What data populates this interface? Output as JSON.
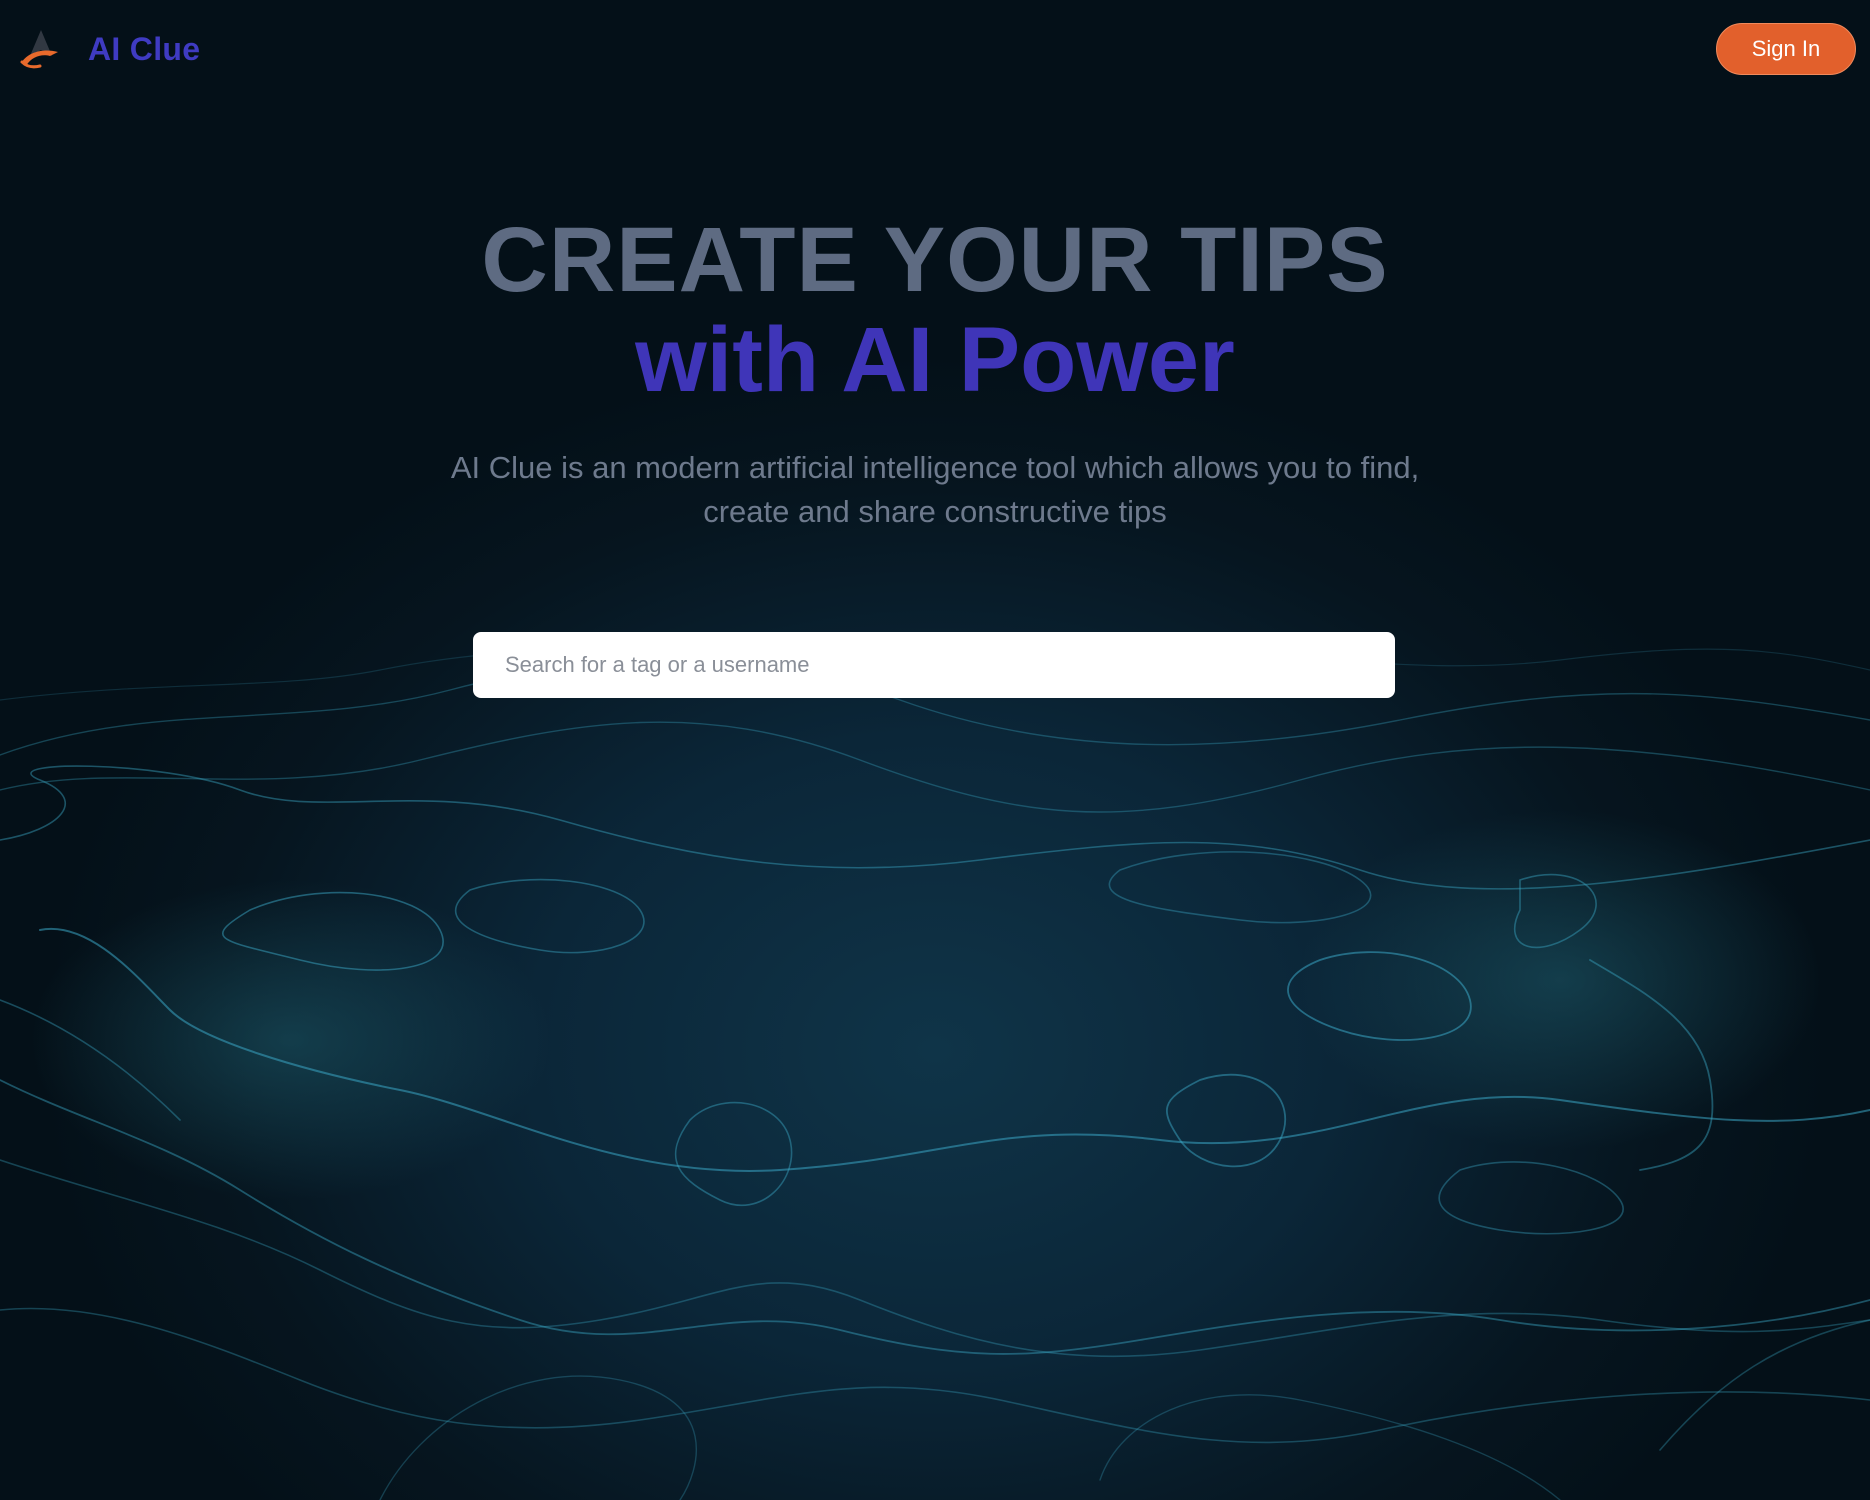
{
  "brand": {
    "name": "AI Clue",
    "logo_icon": "rocket-arrow-icon"
  },
  "header": {
    "signin_label": "Sign In"
  },
  "hero": {
    "title_line1": "CREATE YOUR TIPS",
    "title_line2": "with AI Power",
    "subtitle": "AI Clue is an modern artificial intelligence tool which allows you to find, create and share constructive tips"
  },
  "search": {
    "placeholder": "Search for a tag or a username",
    "value": ""
  },
  "colors": {
    "brand_purple": "#3f3bc2",
    "signin_orange": "#e2602c",
    "title_gray": "#5e6b82",
    "background_dark": "#06141d",
    "glow_cyan": "#6ff3ff"
  }
}
